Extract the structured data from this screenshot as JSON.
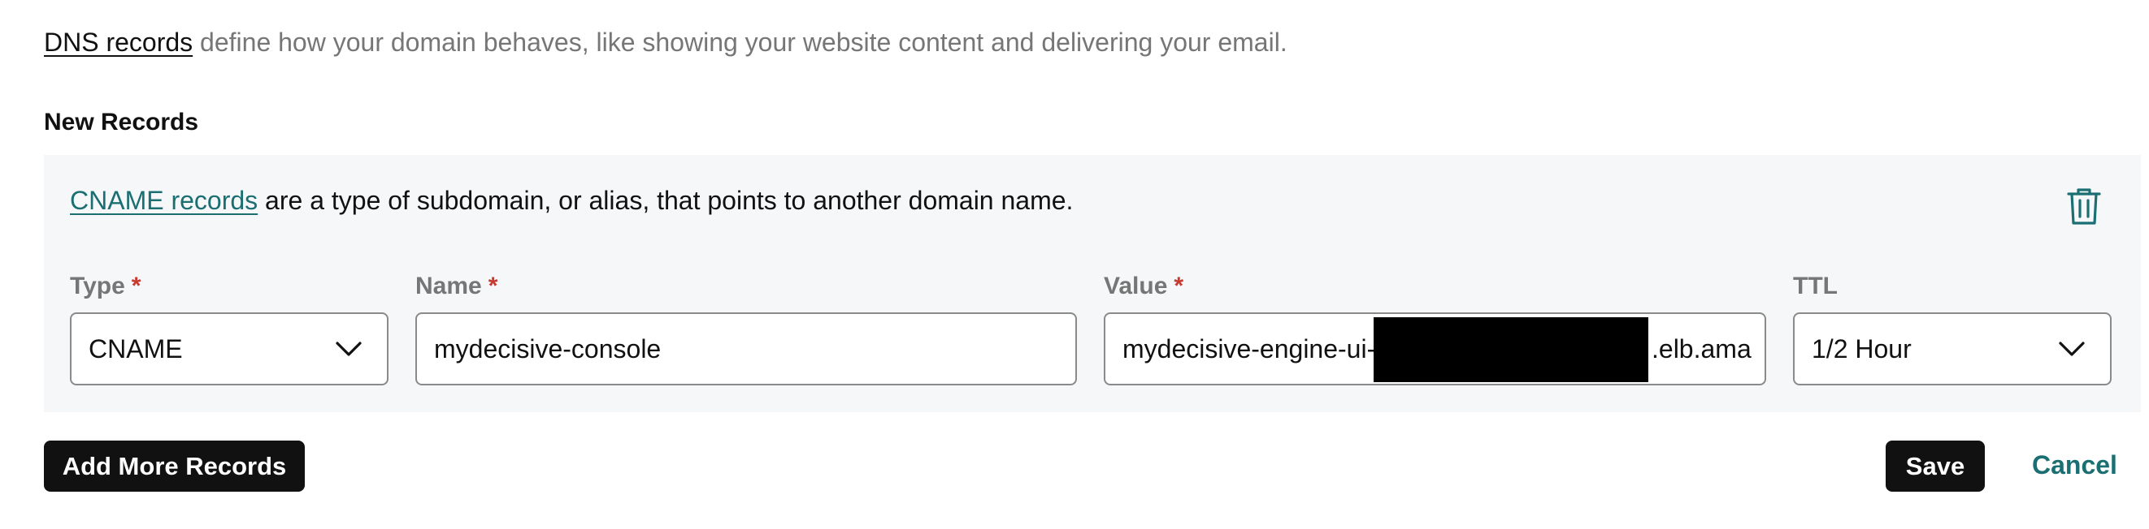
{
  "intro": {
    "link_text": "DNS records",
    "text": " define how your domain behaves, like showing your website content and delivering your email."
  },
  "new_records_heading": "New Records",
  "record": {
    "description_link": "CNAME records",
    "description_text": " are a type of subdomain, or alias, that points to another domain name.",
    "delete_icon": "trash-icon",
    "fields": {
      "type": {
        "label": "Type",
        "required_mark": "*",
        "value": "CNAME"
      },
      "name": {
        "label": "Name",
        "required_mark": "*",
        "value": "mydecisive-console"
      },
      "value": {
        "label": "Value",
        "required_mark": "*",
        "value_prefix": "mydecisive-engine-ui-",
        "value_suffix": ".elb.ama"
      },
      "ttl": {
        "label": "TTL",
        "value": "1/2 Hour"
      }
    }
  },
  "actions": {
    "add_more": "Add More Records",
    "save": "Save",
    "cancel": "Cancel"
  },
  "colors": {
    "link_teal": "#1b6f73",
    "required_red": "#c8382f",
    "panel_bg": "#f5f7f8",
    "button_dark": "#111111"
  }
}
